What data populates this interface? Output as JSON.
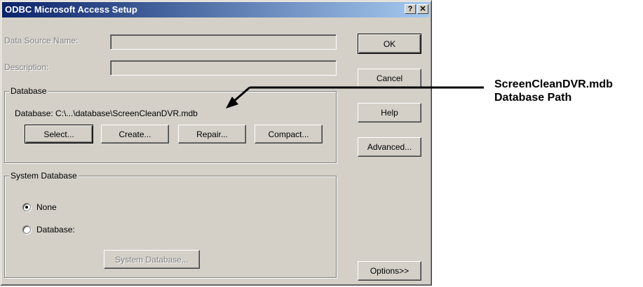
{
  "window": {
    "title": "ODBC Microsoft Access Setup",
    "help_glyph": "?",
    "close_glyph": "✕"
  },
  "fields": {
    "data_source_name_label": "Data Source Name:",
    "data_source_name_value": "",
    "description_label": "Description:",
    "description_value": ""
  },
  "database_group": {
    "title": "Database",
    "path_text": "Database:  C:\\...\\database\\ScreenCleanDVR.mdb",
    "buttons": {
      "select": "Select...",
      "create": "Create...",
      "repair": "Repair...",
      "compact": "Compact..."
    }
  },
  "system_database_group": {
    "title": "System Database",
    "none_label": "None",
    "database_label": "Database:",
    "selected": "None",
    "system_db_button": "System Database..."
  },
  "side_buttons": {
    "ok": "OK",
    "cancel": "Cancel",
    "help": "Help",
    "advanced": "Advanced...",
    "options": "Options>>"
  },
  "annotation": {
    "line1": "ScreenCleanDVR.mdb",
    "line2": "Database Path"
  }
}
